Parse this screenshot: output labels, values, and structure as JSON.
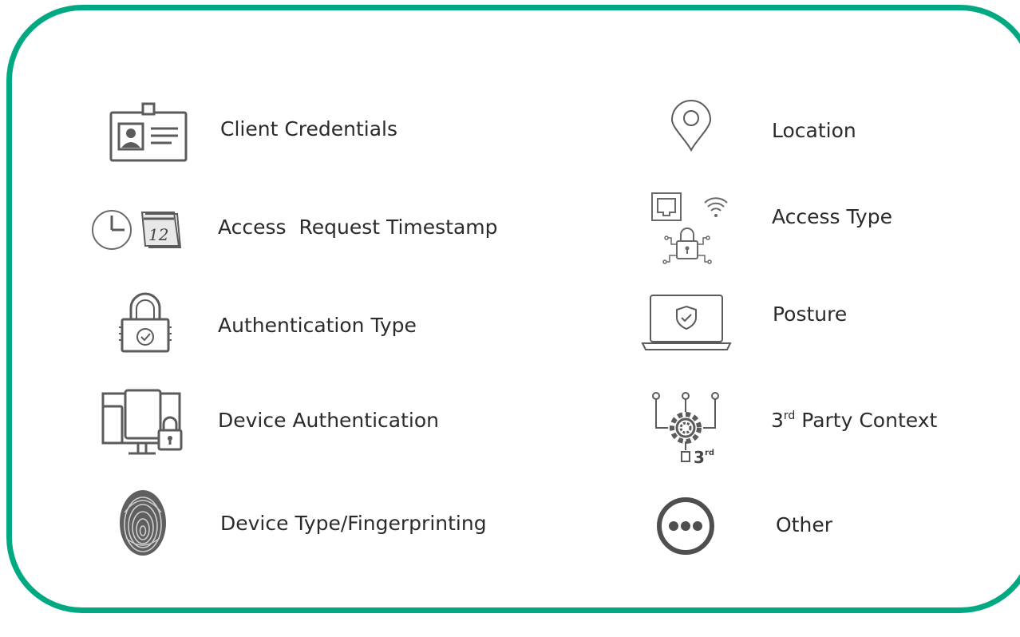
{
  "colors": {
    "frame": "#01A982",
    "icon": "#5b5b5b",
    "text": "#2b2b2b"
  },
  "left_items": [
    {
      "label": "Client Credentials",
      "icon": "id-badge-icon"
    },
    {
      "label": "Access  Request Timestamp",
      "icon": "clock-calendar-icon",
      "calendar_day": "12"
    },
    {
      "label": "Authentication Type",
      "icon": "padlock-check-icon"
    },
    {
      "label": "Device Authentication",
      "icon": "devices-lock-icon"
    },
    {
      "label": "Device Type/Fingerprinting",
      "icon": "fingerprint-icon"
    }
  ],
  "right_items": [
    {
      "label": "Location",
      "icon": "map-pin-icon"
    },
    {
      "label": "Access Type",
      "icon": "ethernet-wifi-lock-icon"
    },
    {
      "label": "Posture",
      "icon": "laptop-shield-icon"
    },
    {
      "label_prefix": "3",
      "label_sup": "rd",
      "label_suffix": " Party Context",
      "icon": "gear-network-3rd-icon",
      "badge_number": "3",
      "badge_sup": "rd"
    },
    {
      "label": "Other",
      "icon": "more-dots-icon"
    }
  ]
}
